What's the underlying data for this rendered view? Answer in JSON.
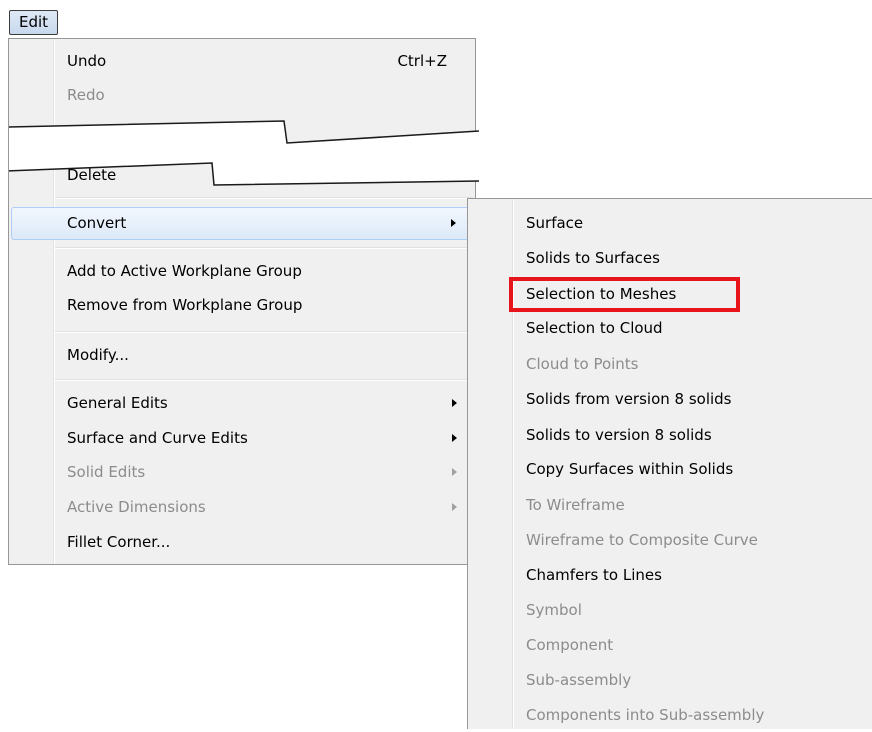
{
  "menubar": {
    "edit_label": "Edit"
  },
  "edit_menu": {
    "items": [
      {
        "label": "Undo",
        "shortcut": "Ctrl+Z",
        "enabled": true
      },
      {
        "label": "Redo",
        "enabled": false
      },
      {
        "label": "Delete",
        "enabled": true
      },
      {
        "label": "Convert",
        "enabled": true,
        "submenu": true,
        "highlighted": true
      },
      {
        "label": "Add to Active Workplane Group",
        "enabled": true
      },
      {
        "label": "Remove from Workplane Group",
        "enabled": true
      },
      {
        "label": "Modify...",
        "enabled": true
      },
      {
        "label": "General Edits",
        "enabled": true,
        "submenu": true
      },
      {
        "label": "Surface and Curve Edits",
        "enabled": true,
        "submenu": true
      },
      {
        "label": "Solid Edits",
        "enabled": false,
        "submenu": true
      },
      {
        "label": "Active Dimensions",
        "enabled": false,
        "submenu": true
      },
      {
        "label": "Fillet Corner...",
        "enabled": true
      }
    ]
  },
  "convert_menu": {
    "items": [
      {
        "label": "Surface",
        "enabled": true
      },
      {
        "label": "Solids to Surfaces",
        "enabled": true
      },
      {
        "label": "Selection to Meshes",
        "enabled": true,
        "annotated": true
      },
      {
        "label": "Selection to Cloud",
        "enabled": true
      },
      {
        "label": "Cloud to Points",
        "enabled": false
      },
      {
        "label": "Solids from version 8 solids",
        "enabled": true
      },
      {
        "label": "Solids to version 8 solids",
        "enabled": true
      },
      {
        "label": "Copy Surfaces within Solids",
        "enabled": true
      },
      {
        "label": "To Wireframe",
        "enabled": false
      },
      {
        "label": "Wireframe to Composite Curve",
        "enabled": false
      },
      {
        "label": "Chamfers to Lines",
        "enabled": true
      },
      {
        "label": "Symbol",
        "enabled": false
      },
      {
        "label": "Component",
        "enabled": false
      },
      {
        "label": "Sub-assembly",
        "enabled": false
      },
      {
        "label": "Components into Sub-assembly",
        "enabled": false
      }
    ]
  },
  "colors": {
    "menu_bg": "#f0f0f0",
    "highlight": "#dde9f8",
    "disabled_text": "#8c8c8c",
    "annotation": "#e8141c"
  }
}
